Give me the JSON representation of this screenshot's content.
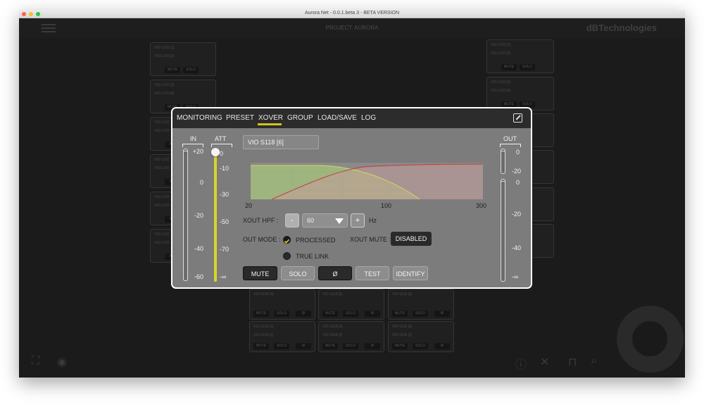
{
  "window": {
    "title": "Aurora Net - 0.0.1.beta 3 - BETA VERSION"
  },
  "appbar": {
    "project": "PROJECT: AURORA",
    "brand": "dBTechnologies"
  },
  "background_cards": {
    "left": [
      {
        "l1": "VIO L210 [1]",
        "l2": "VIO L210 [2]",
        "b1": "MUTE",
        "b2": "SOLO"
      },
      {
        "l1": "VIO L210 [3]",
        "l2": "VIO L210 [4]",
        "b1": "MUTE",
        "b2": "SOLO"
      },
      {
        "l1": "VIO L210",
        "l2": "VIO L210",
        "b1": "MU",
        "b2": ""
      },
      {
        "l1": "VIO L210",
        "l2": "VIO L210",
        "b1": "MU",
        "b2": ""
      },
      {
        "l1": "VIO L210",
        "l2": "VIO L210",
        "b1": "MU",
        "b2": ""
      },
      {
        "l1": "VIO L210",
        "l2": "VIO L210",
        "b1": "MU",
        "b2": ""
      }
    ],
    "right": [
      {
        "l1": "VIO L210 [1]",
        "l2": "VIO L210 [2]",
        "b1": "MUTE",
        "b2": "SOLO"
      },
      {
        "l1": "VIO L210 [3]",
        "l2": "VIO L210 [4]",
        "b1": "MUTE",
        "b2": "SOLO"
      }
    ],
    "bottom": [
      {
        "l1": "VIO S118 [4]",
        "l2": "",
        "b1": "MUTE",
        "b2": "SOLO",
        "b3": "Ø"
      },
      {
        "l1": "VIO S118 [5]",
        "l2": "",
        "b1": "MUTE",
        "b2": "SOLO",
        "b3": "Ø"
      },
      {
        "l1": "VIO S118 [6]",
        "l2": "",
        "b1": "MUTE",
        "b2": "SOLO",
        "b3": "Ø"
      },
      {
        "l1": "VIO S118 [1]",
        "l2": "VIO S118 [1]",
        "b1": "MUTE",
        "b2": "SOLO",
        "b3": "Ø"
      },
      {
        "l1": "VIO S118 [2]",
        "l2": "VIO S118 [2]",
        "b1": "MUTE",
        "b2": "SOLO",
        "b3": "Ø"
      },
      {
        "l1": "VIO S118 [3]",
        "l2": "VIO S118 [3]",
        "b1": "MUTE",
        "b2": "SOLO",
        "b3": "Ø"
      }
    ]
  },
  "modal": {
    "tabs": [
      {
        "label": "MONITORING"
      },
      {
        "label": "PRESET"
      },
      {
        "label": "XOVER"
      },
      {
        "label": "GROUP"
      },
      {
        "label": "LOAD/SAVE"
      },
      {
        "label": "LOG"
      }
    ],
    "active_tab": "XOVER",
    "in_meter": {
      "label": "IN",
      "scale": [
        "+20",
        "0",
        "-20",
        "-40",
        "-60"
      ]
    },
    "att_fader": {
      "label": "ATT",
      "scale": [
        "0",
        "-10",
        "-30",
        "-50",
        "-70",
        "-∞"
      ],
      "level_db": "0"
    },
    "out_meter": {
      "label": "OUT",
      "top_scale": [
        "0",
        "-20"
      ],
      "scale": [
        "0",
        "-20",
        "-40",
        "-∞"
      ]
    },
    "device_name": "VIO S118  [6]",
    "xover_graph": {
      "freq_labels": [
        "20",
        "100",
        "300"
      ]
    },
    "xout_hpf": {
      "label": "XOUT HPF :",
      "minus": "-",
      "value": "60",
      "plus": "+",
      "unit": "Hz"
    },
    "out_mode": {
      "label": "OUT MODE :",
      "options": [
        "PROCESSED",
        "TRUE LINK"
      ],
      "selected": "PROCESSED"
    },
    "xout_mute": {
      "label": "XOUT MUTE :",
      "value": "DISABLED"
    },
    "actions": {
      "mute": "MUTE",
      "solo": "SOLO",
      "phase": "Ø",
      "test": "TEST",
      "identify": "IDENTIFY"
    }
  }
}
